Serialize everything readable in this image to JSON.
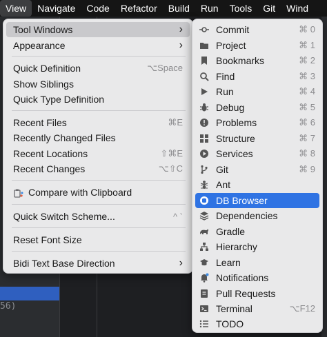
{
  "menubar": [
    "View",
    "Navigate",
    "Code",
    "Refactor",
    "Build",
    "Run",
    "Tools",
    "Git",
    "Wind"
  ],
  "background": {
    "left_text": "56)"
  },
  "view_menu": {
    "items": [
      {
        "label": "Tool Windows",
        "shortcut": "",
        "submenu": true,
        "highlighted": true
      },
      {
        "label": "Appearance",
        "shortcut": "",
        "submenu": true
      },
      {
        "label": "Quick Definition",
        "shortcut": "⌥Space"
      },
      {
        "label": "Show Siblings",
        "shortcut": ""
      },
      {
        "label": "Quick Type Definition",
        "shortcut": ""
      },
      {
        "label": "Recent Files",
        "shortcut": "⌘E"
      },
      {
        "label": "Recently Changed Files",
        "shortcut": ""
      },
      {
        "label": "Recent Locations",
        "shortcut": "⇧⌘E"
      },
      {
        "label": "Recent Changes",
        "shortcut": "⌥⇧C"
      },
      {
        "label": "Compare with Clipboard",
        "shortcut": "",
        "icon": "compare-clipboard-icon"
      },
      {
        "label": "Quick Switch Scheme...",
        "shortcut": "^ `"
      },
      {
        "label": "Reset Font Size",
        "shortcut": ""
      },
      {
        "label": "Bidi Text Base Direction",
        "shortcut": "",
        "submenu": true
      }
    ]
  },
  "tool_windows": {
    "items": [
      {
        "label": "Commit",
        "shortcut": "⌘ 0",
        "icon": "commit-icon"
      },
      {
        "label": "Project",
        "shortcut": "⌘ 1",
        "icon": "folder-icon"
      },
      {
        "label": "Bookmarks",
        "shortcut": "⌘ 2",
        "icon": "bookmark-icon"
      },
      {
        "label": "Find",
        "shortcut": "⌘ 3",
        "icon": "search-icon"
      },
      {
        "label": "Run",
        "shortcut": "⌘ 4",
        "icon": "play-icon"
      },
      {
        "label": "Debug",
        "shortcut": "⌘ 5",
        "icon": "bug-icon"
      },
      {
        "label": "Problems",
        "shortcut": "⌘ 6",
        "icon": "problems-icon"
      },
      {
        "label": "Structure",
        "shortcut": "⌘ 7",
        "icon": "structure-icon"
      },
      {
        "label": "Services",
        "shortcut": "⌘ 8",
        "icon": "services-icon"
      },
      {
        "label": "Git",
        "shortcut": "⌘ 9",
        "icon": "git-branch-icon"
      },
      {
        "label": "Ant",
        "shortcut": "",
        "icon": "ant-icon"
      },
      {
        "label": "DB Browser",
        "shortcut": "",
        "icon": "db-browser-icon",
        "highlighted": true
      },
      {
        "label": "Dependencies",
        "shortcut": "",
        "icon": "dependencies-icon"
      },
      {
        "label": "Gradle",
        "shortcut": "",
        "icon": "gradle-icon"
      },
      {
        "label": "Hierarchy",
        "shortcut": "",
        "icon": "hierarchy-icon"
      },
      {
        "label": "Learn",
        "shortcut": "",
        "icon": "learn-icon"
      },
      {
        "label": "Notifications",
        "shortcut": "",
        "icon": "bell-icon"
      },
      {
        "label": "Pull Requests",
        "shortcut": "",
        "icon": "pull-request-icon"
      },
      {
        "label": "Terminal",
        "shortcut": "⌥F12",
        "icon": "terminal-icon"
      },
      {
        "label": "TODO",
        "shortcut": "",
        "icon": "todo-icon"
      }
    ]
  },
  "colors": {
    "highlight": "#2f73e3",
    "menu_bg": "#e9e9ea",
    "menubar_bg": "#151515"
  }
}
